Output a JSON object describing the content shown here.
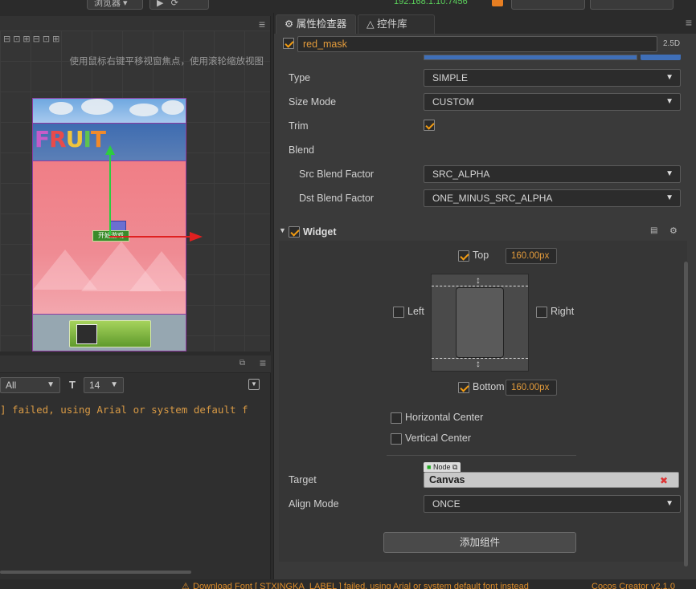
{
  "topbar": {
    "browser_btn": "浏览器",
    "ip_text": "192.168.1.10:7456",
    "btn_a": "",
    "btn_b": ""
  },
  "scene": {
    "hint": "使用鼠标右键平移视窗焦点，使用滚轮缩放视图",
    "preview_title": "FRUIT",
    "tag_text": "开始游戏"
  },
  "console": {
    "filter_value": "All",
    "font_size_value": "14",
    "log_line": "] failed, using Arial or system default f"
  },
  "inspector": {
    "tabs": [
      {
        "label": "属性检查器",
        "icon": "gear-icon"
      },
      {
        "label": "控件库",
        "icon": "triangle-icon"
      }
    ],
    "node_name": "red_mask",
    "mode_label": "2.5D",
    "props": {
      "type_label": "Type",
      "type_value": "SIMPLE",
      "sizemode_label": "Size Mode",
      "sizemode_value": "CUSTOM",
      "trim_label": "Trim",
      "blend_label": "Blend",
      "src_label": "Src Blend Factor",
      "src_value": "SRC_ALPHA",
      "dst_label": "Dst Blend Factor",
      "dst_value": "ONE_MINUS_SRC_ALPHA"
    },
    "widget": {
      "title": "Widget",
      "top_label": "Top",
      "top_value": "160.00px",
      "left_label": "Left",
      "right_label": "Right",
      "bottom_label": "Bottom",
      "bottom_value": "160.00px",
      "hcenter_label": "Horizontal Center",
      "vcenter_label": "Vertical Center",
      "target_label": "Target",
      "node_tag": "Node",
      "target_value": "Canvas",
      "alignmode_label": "Align Mode",
      "alignmode_value": "ONCE"
    },
    "add_component": "添加组件"
  },
  "status": {
    "warning": "Download Font [ STXINGKA_LABEL ] failed, using Arial or system default font instead",
    "brand": "Cocos Creator v2.1.0"
  },
  "colors": {
    "accent": "#f39c12",
    "panel_bg": "#3a3a3a",
    "warning": "#e08e2a"
  }
}
